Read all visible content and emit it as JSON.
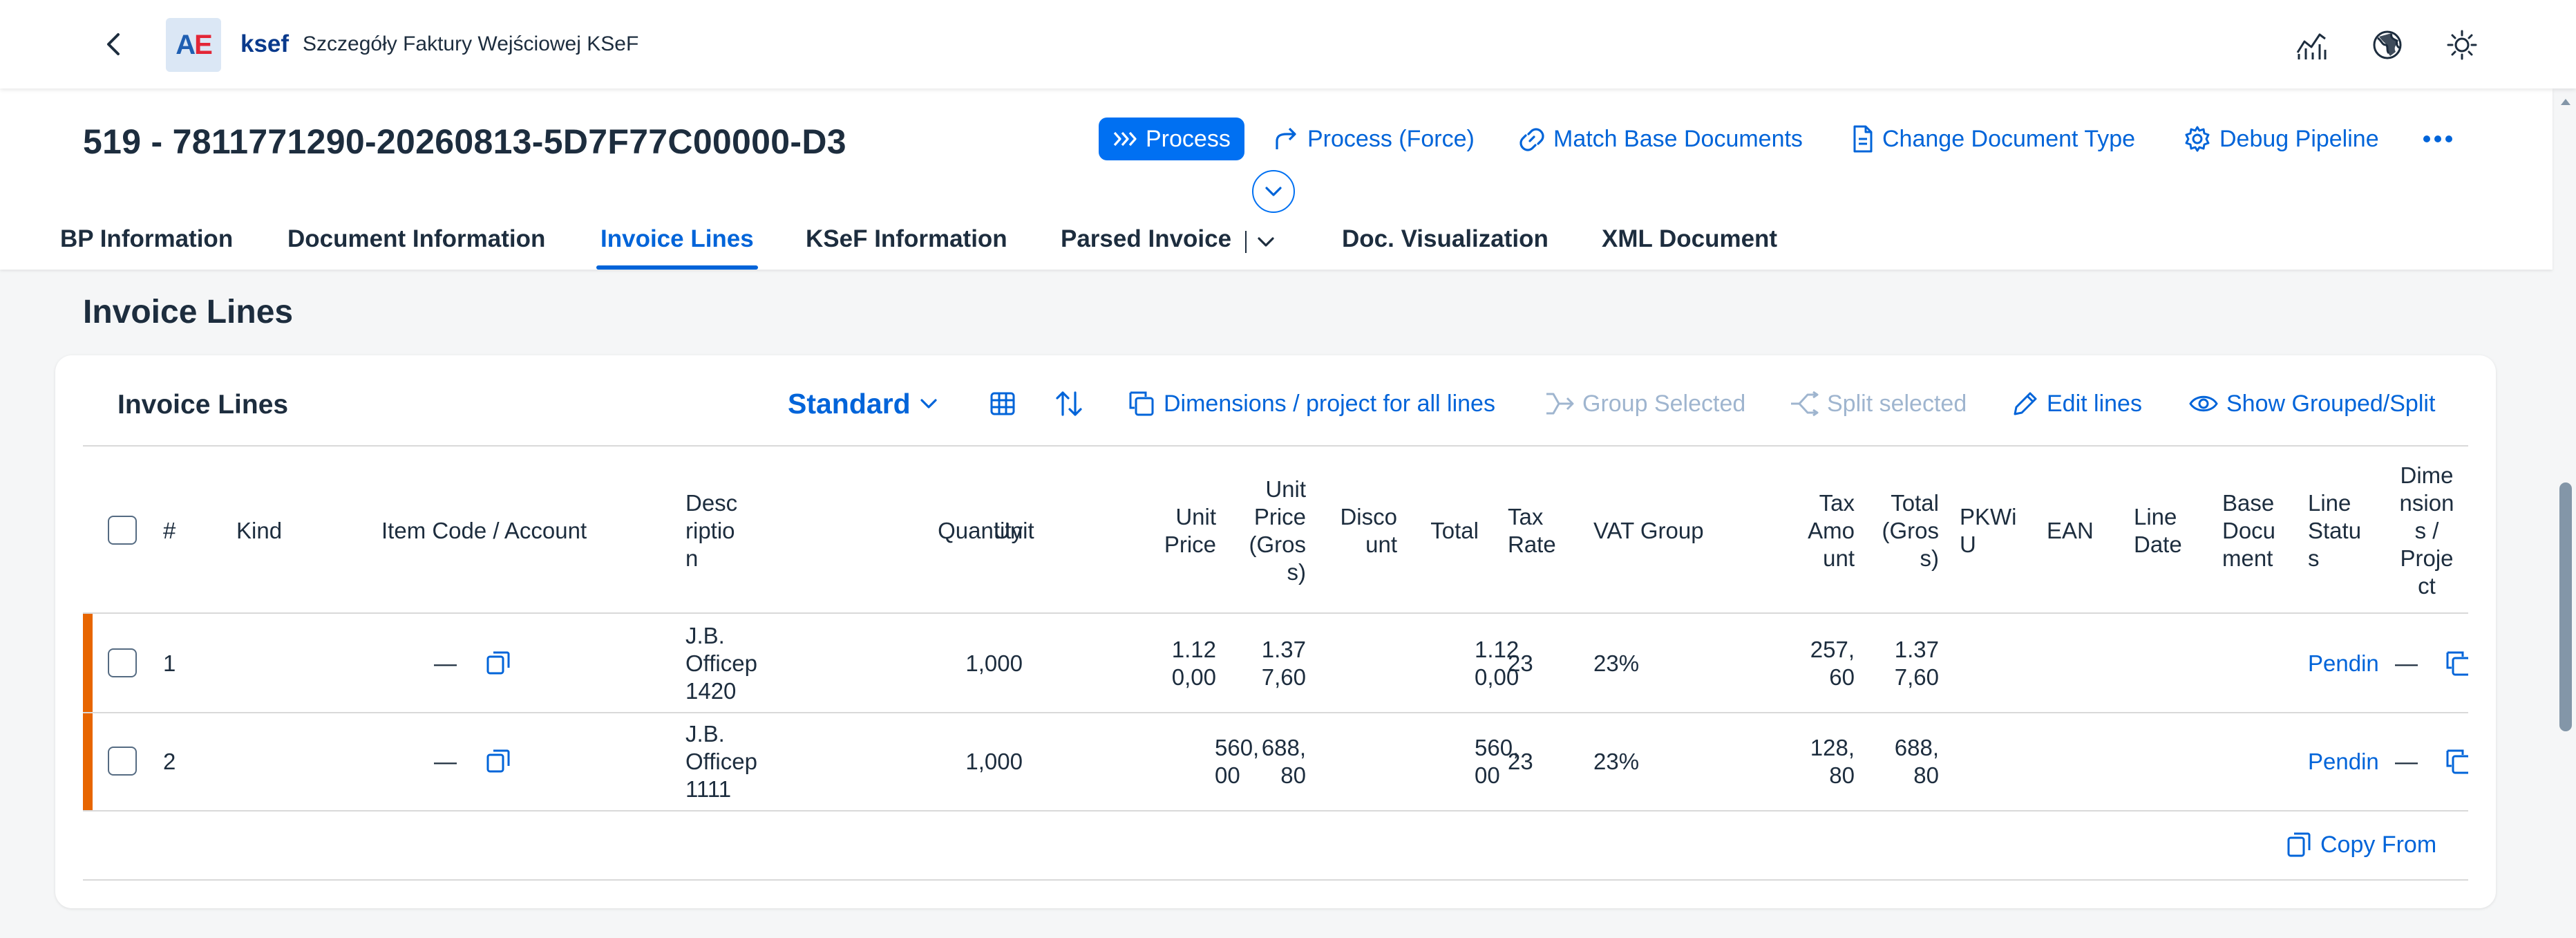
{
  "shell": {
    "logo_a": "A",
    "logo_e": "E",
    "brand": "ksef",
    "app_title": "Szczegóły Faktury Wejściowej KSeF"
  },
  "header": {
    "title": "519 - 7811771290-20260813-5D7F77C00000-D3",
    "actions": {
      "process": "Process",
      "process_force": "Process (Force)",
      "match": "Match Base Documents",
      "change_type": "Change Document Type",
      "debug": "Debug Pipeline"
    }
  },
  "tabs": [
    "BP Information",
    "Document Information",
    "Invoice Lines",
    "KSeF Information",
    "Parsed Invoice",
    "Doc. Visualization",
    "XML Document"
  ],
  "section": {
    "title": "Invoice Lines"
  },
  "table": {
    "title": "Invoice Lines",
    "variant": "Standard",
    "toolbar": {
      "dimensions": "Dimensions / project for all lines",
      "group": "Group Selected",
      "split": "Split selected",
      "edit": "Edit lines",
      "show": "Show Grouped/Split"
    },
    "headers": {
      "num": "#",
      "kind": "Kind",
      "item": "Item Code / Account",
      "desc": [
        "Desc",
        "riptio",
        "n"
      ],
      "qty": "Quantity",
      "unit": "Unit",
      "uprice": [
        "Unit",
        "Price"
      ],
      "upricegross": [
        "Unit",
        "Price",
        "(Gros",
        "s)"
      ],
      "discount": [
        "Disco",
        "unt"
      ],
      "total": "Total",
      "taxrate": [
        "Tax",
        "Rate"
      ],
      "vatgroup": "VAT Group",
      "taxamount": [
        "Tax",
        "Amo",
        "unt"
      ],
      "totalgross": [
        "Total",
        "(Gros",
        "s)"
      ],
      "pkwiu": [
        "PKWi",
        "U"
      ],
      "ean": "EAN",
      "linedate": [
        "Line",
        "Date"
      ],
      "basedoc": [
        "Base",
        "Docu",
        "ment"
      ],
      "linestatus": [
        "Line",
        "Statu",
        "s"
      ],
      "dims": [
        "Dime",
        "nsion",
        "s /",
        "Proje",
        "ct"
      ]
    },
    "rows": [
      {
        "num": "1",
        "item": "—",
        "desc": [
          "J.B.",
          "Officep",
          "1420"
        ],
        "qty": "1,000",
        "uprice": [
          "1.12",
          "0,00"
        ],
        "upricegross": [
          "1.37",
          "7,60"
        ],
        "total": [
          "1.12",
          "0,00"
        ],
        "taxrate": "23",
        "vatgroup": "23%",
        "taxamount": [
          "257,",
          "60"
        ],
        "totalgross": [
          "1.37",
          "7,60"
        ],
        "status": "Pendin",
        "dims": "—"
      },
      {
        "num": "2",
        "item": "—",
        "desc": [
          "J.B.",
          "Officep",
          "1111"
        ],
        "qty": "1,000",
        "uprice": [
          "560,",
          "00"
        ],
        "upricegross": [
          "688,",
          "80"
        ],
        "total": [
          "560,",
          "00"
        ],
        "taxrate": "23",
        "vatgroup": "23%",
        "taxamount": [
          "128,",
          "80"
        ],
        "totalgross": [
          "688,",
          "80"
        ],
        "status": "Pendin",
        "dims": "—"
      }
    ],
    "copy_from": "Copy From"
  },
  "colors": {
    "accent": "#0070f2",
    "link": "#0064d9",
    "row_highlight": "#e76500"
  }
}
